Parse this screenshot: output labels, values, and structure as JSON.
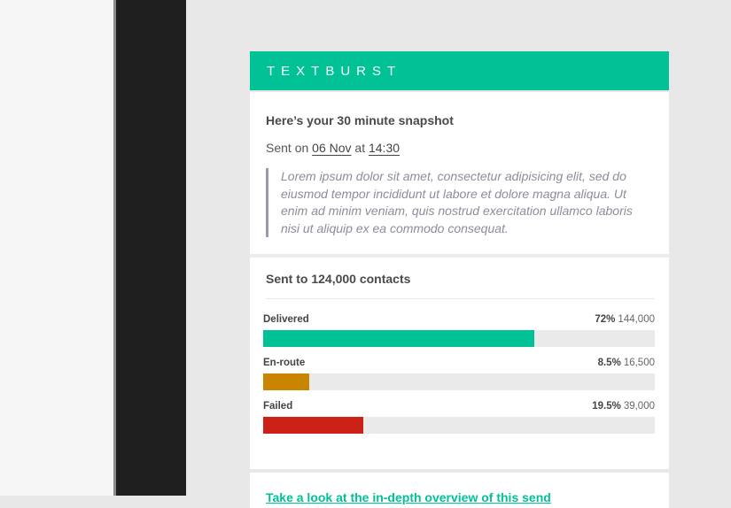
{
  "brand": {
    "name": "TEXTBURST",
    "color": "#00c296"
  },
  "snapshot": {
    "title": "Here’s your 30 minute snapshot",
    "sent_prefix": "Sent on",
    "date": "06 Nov",
    "at": "at",
    "time": "14:30",
    "message": "Lorem ipsum dolor sit amet, consectetur adipisicing elit, sed do eiusmod tempor incididunt ut labore et dolore magna aliqua. Ut enim ad minim veniam, quis nostrud exercitation ullamco laboris nisi ut aliquip ex ea commodo consequat."
  },
  "stats": {
    "title": "Sent to 124,000 contacts",
    "rows": [
      {
        "label": "Delivered",
        "percent": "72%",
        "count": "144,000",
        "fraction": 0.692,
        "color": "#00c296"
      },
      {
        "label": "En-route",
        "percent": "8.5%",
        "count": "16,500",
        "fraction": 0.118,
        "color": "#c98500"
      },
      {
        "label": "Failed",
        "percent": "19.5%",
        "count": "39,000",
        "fraction": 0.256,
        "color": "#cc2116"
      }
    ]
  },
  "footer": {
    "link_text": "Take a look at the in-depth overview of this send"
  }
}
